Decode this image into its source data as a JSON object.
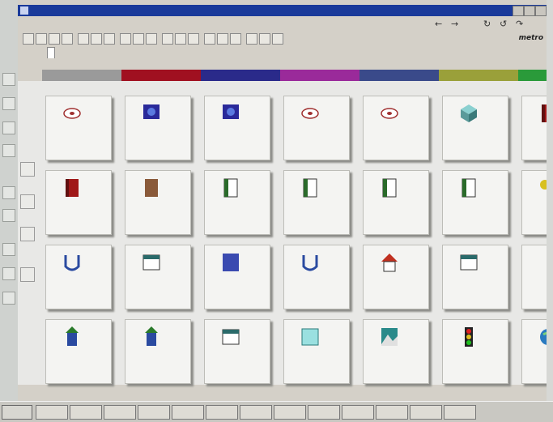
{
  "window": {
    "title": "",
    "brand_text": "metro"
  },
  "menu": {
    "items": [
      "",
      "",
      "",
      "",
      "",
      ""
    ]
  },
  "tabs": [
    {
      "label": ""
    },
    {
      "label": ""
    },
    {
      "label": ""
    }
  ],
  "color_bar": [
    "#9a9a9a",
    "#a01020",
    "#2a2a8a",
    "#9a2a9a",
    "#3a4a8a",
    "#9aa03a",
    "#2a9a3a"
  ],
  "tiles": [
    {
      "name": "tile-1",
      "icon": "disc-icon",
      "label": ""
    },
    {
      "name": "tile-2",
      "icon": "monitor-icon",
      "label": ""
    },
    {
      "name": "tile-3",
      "icon": "monitor-icon",
      "label": ""
    },
    {
      "name": "tile-4",
      "icon": "disc-icon",
      "label": ""
    },
    {
      "name": "tile-5",
      "icon": "disc-icon",
      "label": ""
    },
    {
      "name": "tile-6",
      "icon": "cube-icon",
      "label": ""
    },
    {
      "name": "tile-7",
      "icon": "book-red-icon",
      "label": ""
    },
    {
      "name": "tile-8",
      "icon": "book-red-icon",
      "label": ""
    },
    {
      "name": "tile-9",
      "icon": "book-brown-icon",
      "label": ""
    },
    {
      "name": "tile-10",
      "icon": "book-icon",
      "label": ""
    },
    {
      "name": "tile-11",
      "icon": "book-icon",
      "label": ""
    },
    {
      "name": "tile-12",
      "icon": "book-icon",
      "label": ""
    },
    {
      "name": "tile-13",
      "icon": "book-icon",
      "label": ""
    },
    {
      "name": "tile-14",
      "icon": "key-icon",
      "label": ""
    },
    {
      "name": "tile-15",
      "icon": "u-shape-icon",
      "label": ""
    },
    {
      "name": "tile-16",
      "icon": "calendar-icon",
      "label": ""
    },
    {
      "name": "tile-17",
      "icon": "grid-icon",
      "label": ""
    },
    {
      "name": "tile-18",
      "icon": "u-shape-icon",
      "label": ""
    },
    {
      "name": "tile-19",
      "icon": "house-icon",
      "label": ""
    },
    {
      "name": "tile-20",
      "icon": "calendar-icon",
      "label": ""
    },
    {
      "name": "tile-21",
      "icon": "flag-icon",
      "label": ""
    },
    {
      "name": "tile-22",
      "icon": "building-icon",
      "label": ""
    },
    {
      "name": "tile-23",
      "icon": "building-icon",
      "label": ""
    },
    {
      "name": "tile-24",
      "icon": "calendar-icon",
      "label": ""
    },
    {
      "name": "tile-25",
      "icon": "card-icon",
      "label": ""
    },
    {
      "name": "tile-26",
      "icon": "landscape-icon",
      "label": ""
    },
    {
      "name": "tile-27",
      "icon": "traffic-light-icon",
      "label": ""
    },
    {
      "name": "tile-28",
      "icon": "globe-icon",
      "label": ""
    }
  ],
  "taskbar": {
    "start_label": "",
    "clock": ""
  },
  "status_text": ""
}
